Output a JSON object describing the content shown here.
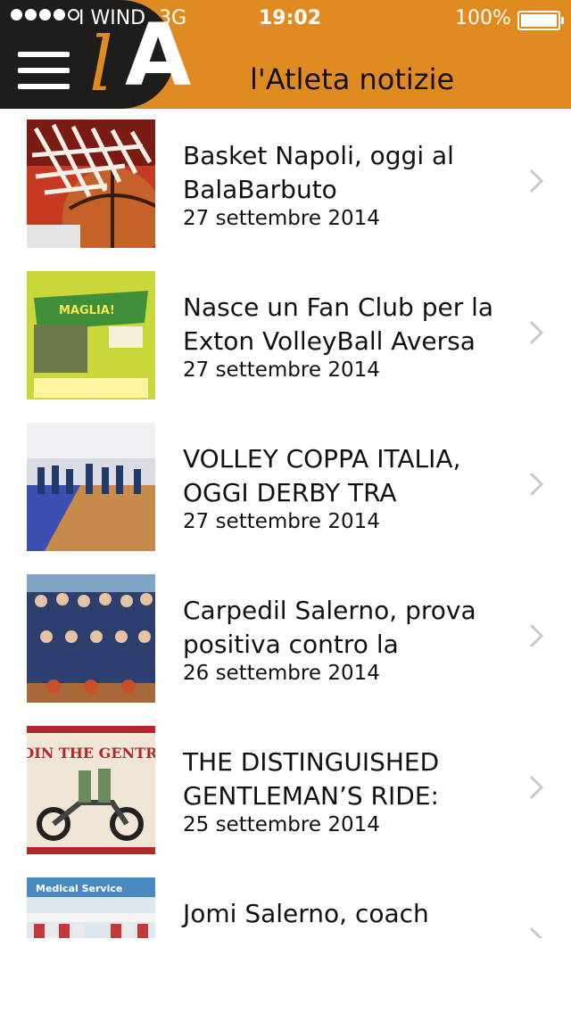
{
  "status_bar": {
    "carrier": "I WIND",
    "network": "3G",
    "time": "19:02",
    "battery": "100%"
  },
  "header": {
    "logo_l": "l",
    "logo_a": "A",
    "title": "l'Atleta notizie",
    "accent_color": "#e08a22"
  },
  "articles": [
    {
      "title": "Basket Napoli, oggi al BalaBarbuto",
      "date": "27 settembre 2014",
      "thumb_icon": "basketball-net-photo"
    },
    {
      "title": "Nasce un Fan Club per la Exton VolleyBall Aversa",
      "date": "27 settembre 2014",
      "thumb_icon": "fan-club-poster",
      "thumb_text": "MAGLIA!"
    },
    {
      "title": "VOLLEY COPPA ITALIA, OGGI DERBY TRA",
      "date": "27 settembre 2014",
      "thumb_icon": "volleyball-court-photo"
    },
    {
      "title": "Carpedil Salerno, prova positiva contro la",
      "date": "26 settembre 2014",
      "thumb_icon": "team-photo"
    },
    {
      "title": "THE DISTINGUISHED GENTLEMAN’S RIDE:",
      "date": "25 settembre 2014",
      "thumb_icon": "motorcycle-poster",
      "thumb_text": "JOIN THE GENTRY"
    },
    {
      "title": "Jomi Salerno, coach",
      "date": "",
      "thumb_icon": "handball-team-photo",
      "thumb_text": "Medical Service"
    }
  ]
}
